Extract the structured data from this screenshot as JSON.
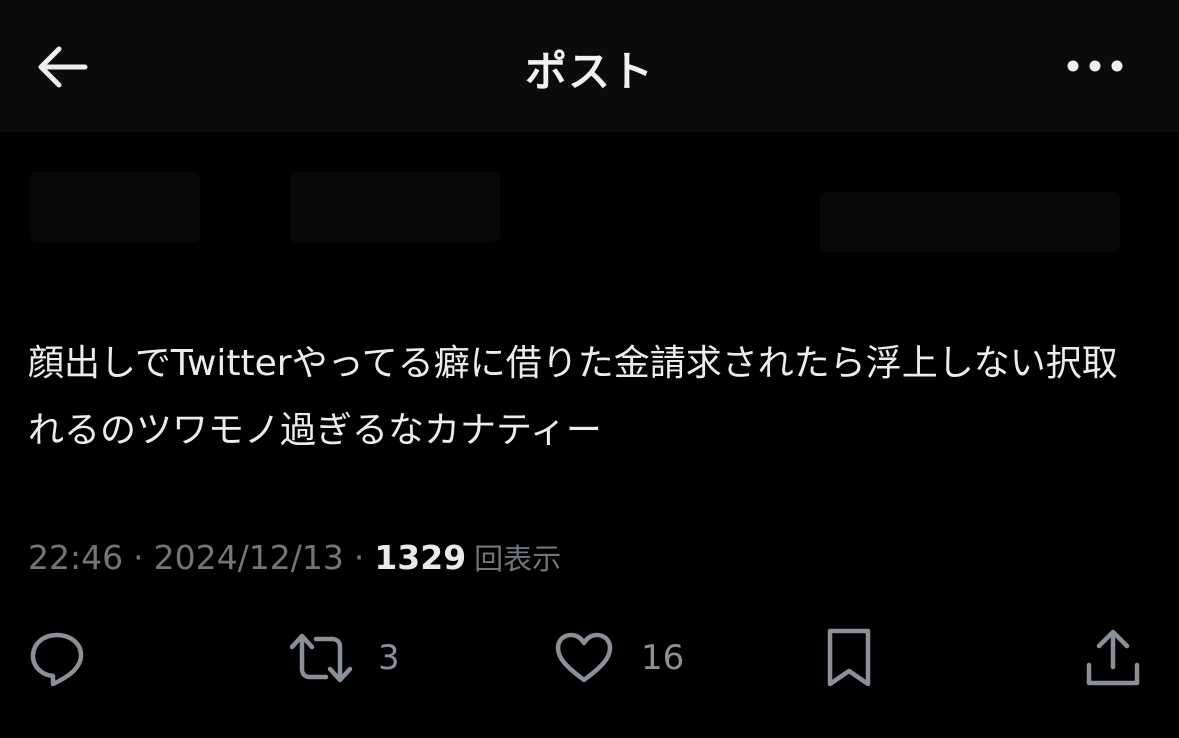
{
  "header": {
    "title": "ポスト",
    "back_icon": "arrow-left-icon",
    "more_icon": "more-horizontal-icon"
  },
  "post": {
    "text": "顔出しでTwitterやってる癖に借りた金請求されたら浮上しない択取れるのツワモノ過ぎるなカナティー",
    "time": "22:46",
    "separator": "·",
    "date": "2024/12/13",
    "views_count": "1329",
    "views_label": "回表示"
  },
  "actions": {
    "reply": {
      "icon": "reply-icon"
    },
    "repost": {
      "icon": "repost-icon",
      "count": "3"
    },
    "like": {
      "icon": "heart-icon",
      "count": "16"
    },
    "bookmark": {
      "icon": "bookmark-icon"
    },
    "share": {
      "icon": "share-icon"
    }
  },
  "colors": {
    "background": "#000000",
    "header_bg": "#0b0b0b",
    "text": "#e7e9ea",
    "muted": "#71767b"
  }
}
